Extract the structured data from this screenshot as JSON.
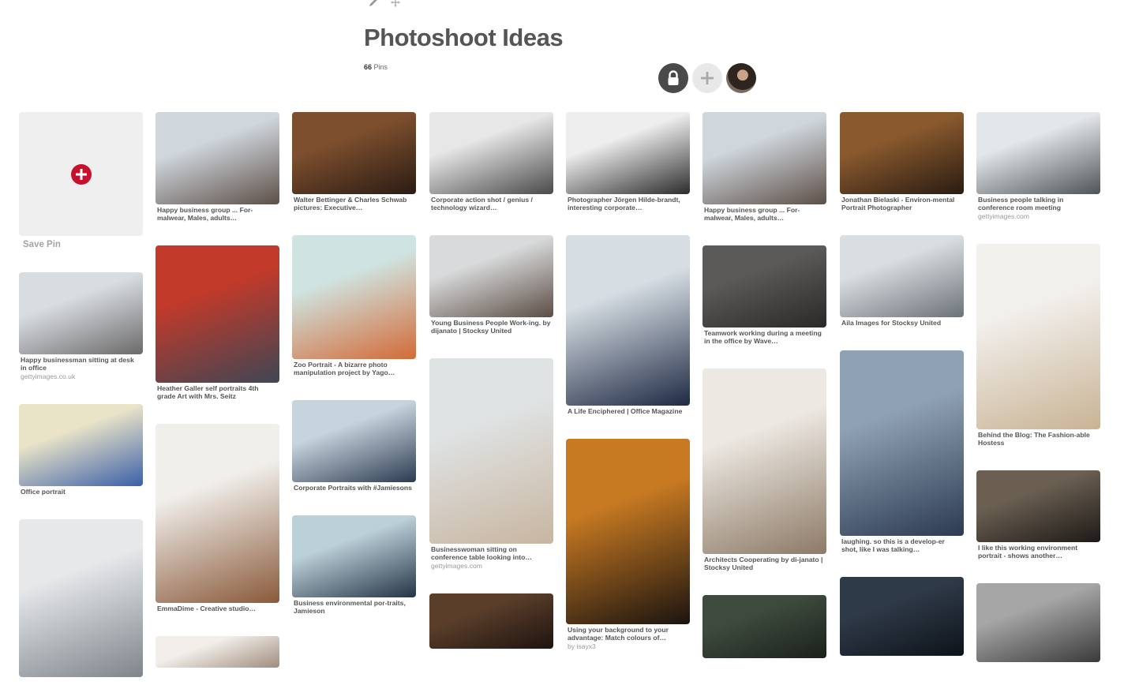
{
  "board": {
    "title": "Photoshoot Ideas",
    "pin_count": "66",
    "pin_count_label": "Pins"
  },
  "icons": {
    "edit": "pencil-icon",
    "move": "move-icon",
    "secret": "lock-icon",
    "add_collaborator": "plus-icon"
  },
  "save_pin": {
    "label": "Save Pin"
  },
  "columns": [
    {
      "pins": [
        {
          "kind": "save"
        },
        {
          "desc": "Happy businessman sitting at desk in office",
          "source": "gettyimages.co.uk",
          "h": 104,
          "c1": "#d9dde2",
          "c2": "#6b6a6a"
        },
        {
          "desc": "Office portrait",
          "source": "",
          "h": 104,
          "c1": "#e9e3c8",
          "c2": "#3a5fa8"
        },
        {
          "desc": "",
          "source": "",
          "h": 200,
          "c1": "#e6e8ea",
          "c2": "#7f858c"
        }
      ]
    },
    {
      "pins": [
        {
          "desc": "Happy business group ... For-malwear, Males, adults…",
          "source": "",
          "h": 117,
          "c1": "#cfd6dc",
          "c2": "#5d4f48"
        },
        {
          "desc": "Heather Galler self portraits 4th grade Art with Mrs. Seitz",
          "source": "",
          "h": 174,
          "c1": "#c23a2a",
          "c2": "#3f4654"
        },
        {
          "desc": "EmmaDime - Creative studio…",
          "source": "",
          "h": 227,
          "c1": "#f1efec",
          "c2": "#8a5a3a"
        },
        {
          "desc": "",
          "source": "",
          "h": 40,
          "c1": "#f2efeb",
          "c2": "#a08c7c"
        }
      ]
    },
    {
      "pins": [
        {
          "desc": "Walter Bettinger & Charles Schwab pictures: Executive…",
          "source": "",
          "h": 104,
          "c1": "#7d4f2e",
          "c2": "#2b1c14"
        },
        {
          "desc": "Zoo Portrait - A bizarre photo manipulation project by Yago…",
          "source": "",
          "h": 157,
          "c1": "#cfe3e0",
          "c2": "#d36a37"
        },
        {
          "desc": "Corporate Portraits with #Jamiesons",
          "source": "",
          "h": 104,
          "c1": "#c6d4dd",
          "c2": "#2d3b52"
        },
        {
          "desc": "Business environmental por-traits, Jamieson",
          "source": "",
          "h": 104,
          "c1": "#bcd0d8",
          "c2": "#253447"
        }
      ]
    },
    {
      "pins": [
        {
          "desc": "Corporate action shot / genius / technology wizard…",
          "source": "",
          "h": 104,
          "c1": "#e7e7e7",
          "c2": "#4a4a4a"
        },
        {
          "desc": "Young Business People Work-ing. by dijanato | Stocksy United",
          "source": "",
          "h": 104,
          "c1": "#d8dadb",
          "c2": "#5b4d45"
        },
        {
          "desc": "Businesswoman sitting on conference table looking into…",
          "source": "gettyimages.com",
          "h": 235,
          "c1": "#dfe3e4",
          "c2": "#c8b5a0"
        },
        {
          "desc": "",
          "source": "",
          "h": 70,
          "c1": "#5a3e2a",
          "c2": "#1e1410"
        }
      ]
    },
    {
      "pins": [
        {
          "desc": "Photographer Jörgen Hilde-brandt, interesting corporate…",
          "source": "",
          "h": 104,
          "c1": "#eeeeee",
          "c2": "#2c2c2c"
        },
        {
          "desc": "A Life Enciphered | Office Magazine",
          "source": "",
          "h": 216,
          "c1": "#d6dde3",
          "c2": "#1f2a44"
        },
        {
          "desc": "Using your background to your advantage: Match colours of…",
          "source": "by isayx3",
          "h": 235,
          "c1": "#c87a22",
          "c2": "#1b1410"
        }
      ]
    },
    {
      "pins": [
        {
          "desc": "Happy business group ... For-malwear, Males, adults…",
          "source": "",
          "h": 117,
          "c1": "#cfd6dc",
          "c2": "#5d4f48"
        },
        {
          "desc": "Teamwork working during a meeting in the office by Wave…",
          "source": "",
          "h": 104,
          "c1": "#5c5a58",
          "c2": "#2a2928"
        },
        {
          "desc": "Architects Cooperating by di-janato | Stocksy United",
          "source": "",
          "h": 235,
          "c1": "#ece8e2",
          "c2": "#8d7a66"
        },
        {
          "desc": "",
          "source": "",
          "h": 80,
          "c1": "#3e4a3e",
          "c2": "#1b211b"
        }
      ]
    },
    {
      "pins": [
        {
          "desc": "Jonathan Bielaski - Environ-mental Portrait Photographer",
          "source": "",
          "h": 104,
          "c1": "#8a5a2e",
          "c2": "#2a1c12"
        },
        {
          "desc": "Aila Images for Stocksy United",
          "source": "",
          "h": 104,
          "c1": "#d9dee1",
          "c2": "#6c7279"
        },
        {
          "desc": "laughing. so this is a develop-er shot, like I was talking…",
          "source": "",
          "h": 235,
          "c1": "#8fa2b3",
          "c2": "#2c3a52"
        },
        {
          "desc": "",
          "source": "",
          "h": 100,
          "c1": "#2f3a48",
          "c2": "#0e131a"
        }
      ]
    },
    {
      "pins": [
        {
          "desc": "Business people talking in conference room meeting",
          "source": "gettyimages.com",
          "h": 104,
          "c1": "#e4e7e9",
          "c2": "#505458"
        },
        {
          "desc": "Behind the Blog: The Fashion-able Hostess",
          "source": "",
          "h": 235,
          "c1": "#f2f0ed",
          "c2": "#c9b394"
        },
        {
          "desc": "I like this working environment portrait - shows another…",
          "source": "",
          "h": 91,
          "c1": "#6b5f52",
          "c2": "#1d1a17"
        },
        {
          "desc": "",
          "source": "",
          "h": 100,
          "c1": "#a6a6a6",
          "c2": "#3a3a3a"
        }
      ]
    }
  ]
}
